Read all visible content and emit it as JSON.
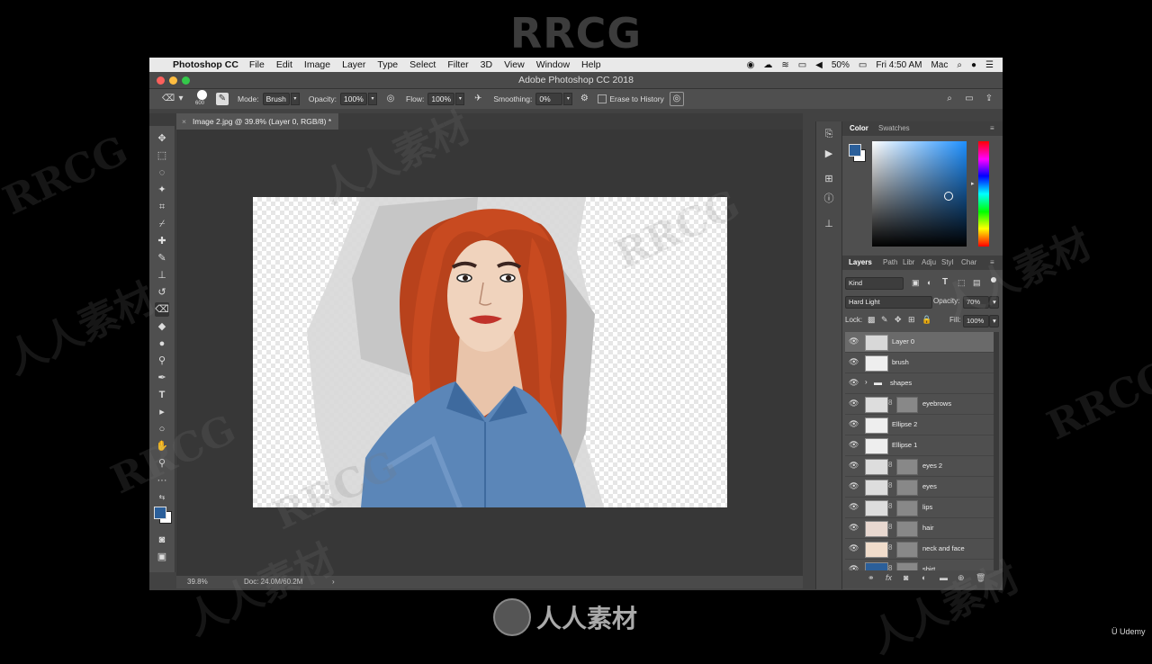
{
  "watermark": {
    "top": "RRCG",
    "bottom": "人人素材",
    "corner": "Udemy",
    "repeat_text": "RRCG",
    "repeat_cn": "人人素材"
  },
  "menubar": {
    "app_name": "Photoshop CC",
    "items": [
      "File",
      "Edit",
      "Image",
      "Layer",
      "Type",
      "Select",
      "Filter",
      "3D",
      "View",
      "Window",
      "Help"
    ],
    "battery": "50%",
    "clock": "Fri 4:50 AM",
    "user": "Mac"
  },
  "window": {
    "title": "Adobe Photoshop CC 2018"
  },
  "options": {
    "brush_size": "600",
    "mode_label": "Mode:",
    "mode_value": "Brush",
    "opacity_label": "Opacity:",
    "opacity_value": "100%",
    "flow_label": "Flow:",
    "flow_value": "100%",
    "smoothing_label": "Smoothing:",
    "smoothing_value": "0%",
    "erase_label": "Erase to History"
  },
  "document": {
    "tab": "Image 2.jpg @ 39.8% (Layer 0, RGB/8) *",
    "zoom": "39.8%",
    "doc_info": "Doc: 24.0M/60.2M"
  },
  "color_panel": {
    "tabs": [
      "Color",
      "Swatches"
    ],
    "fg": "#2b5f9a",
    "bg": "#ffffff"
  },
  "layers_panel": {
    "tabs": [
      "Layers",
      "Path",
      "Libr",
      "Adju",
      "Styl",
      "Char"
    ],
    "filter": "Kind",
    "blend_mode": "Hard Light",
    "opacity_label": "Opacity:",
    "opacity": "70%",
    "lock_label": "Lock:",
    "fill_label": "Fill:",
    "fill": "100%",
    "layers": [
      {
        "name": "Layer 0",
        "selected": true
      },
      {
        "name": "brush"
      },
      {
        "name": "shapes",
        "group": true
      },
      {
        "name": "eyebrows"
      },
      {
        "name": "Ellipse 2"
      },
      {
        "name": "Ellipse 1"
      },
      {
        "name": "eyes 2"
      },
      {
        "name": "eyes"
      },
      {
        "name": "lips"
      },
      {
        "name": "hair"
      },
      {
        "name": "neck and face"
      },
      {
        "name": "shirt"
      }
    ]
  }
}
